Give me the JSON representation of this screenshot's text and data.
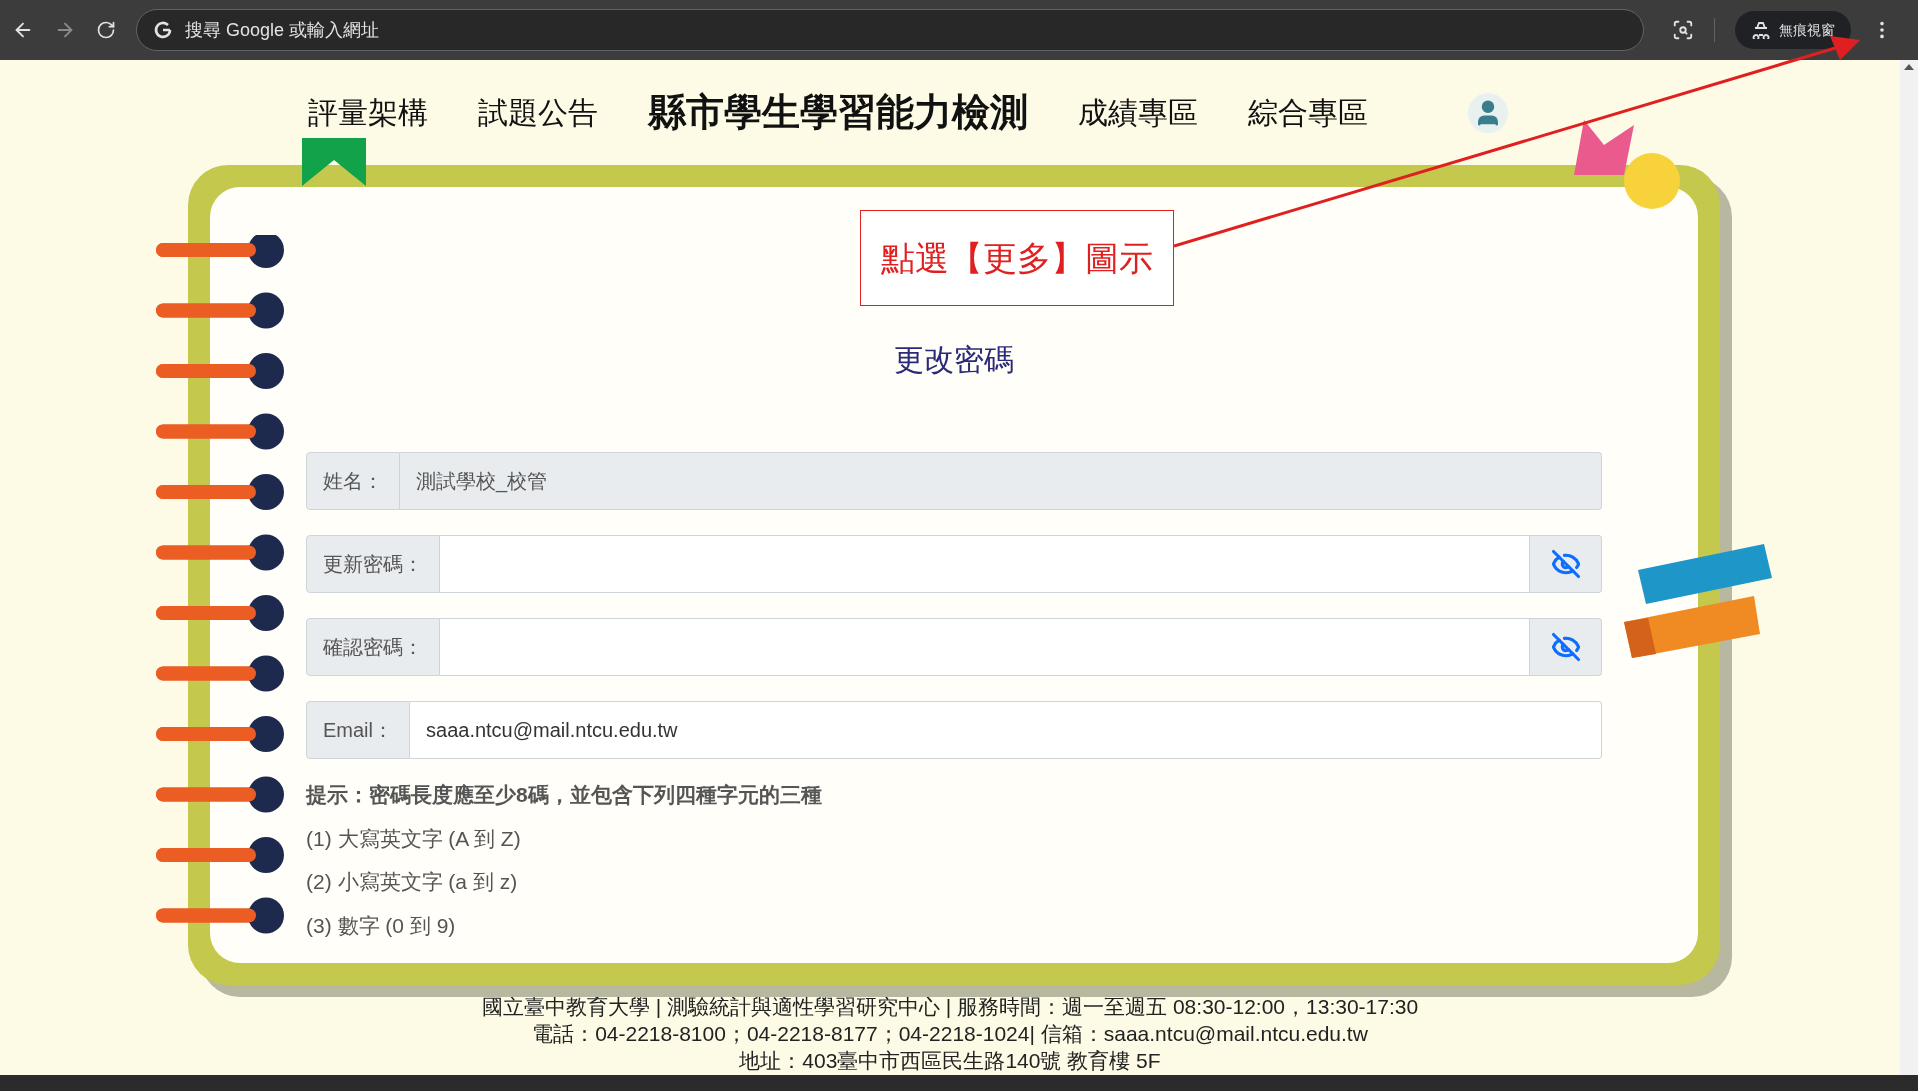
{
  "browser": {
    "address_placeholder": "搜尋 Google 或輸入網址",
    "incognito_label": "無痕視窗"
  },
  "nav": [
    {
      "kind": "link",
      "label": "評量架構"
    },
    {
      "kind": "link",
      "label": "試題公告"
    },
    {
      "kind": "title",
      "label": "縣市學生學習能力檢測"
    },
    {
      "kind": "link",
      "label": "成績專區"
    },
    {
      "kind": "link",
      "label": "綜合專區"
    }
  ],
  "annotation": {
    "text": "點選【更多】圖示"
  },
  "form": {
    "title": "更改密碼",
    "fields": [
      {
        "kind": "readonly",
        "label": "姓名：",
        "value": "測試學校_校管"
      },
      {
        "kind": "password",
        "label": "更新密碼："
      },
      {
        "kind": "password",
        "label": "確認密碼："
      },
      {
        "kind": "text",
        "label": "Email：",
        "value": "saaa.ntcu@mail.ntcu.edu.tw"
      }
    ],
    "hints": [
      "提示：密碼長度應至少8碼，並包含下列四種字元的三種",
      "(1) 大寫英文字 (A 到 Z)",
      "(2) 小寫英文字 (a 到 z)",
      "(3) 數字 (0 到 9)"
    ]
  },
  "footer": [
    "國立臺中教育大學 | 測驗統計與適性學習研究中心 | 服務時間：週一至週五 08:30-12:00，13:30-17:30",
    "電話：04-2218-8100；04-2218-8177；04-2218-1024| 信箱：saaa.ntcu@mail.ntcu.edu.tw",
    "地址：403臺中市西區民生路140號 教育樓 5F"
  ]
}
